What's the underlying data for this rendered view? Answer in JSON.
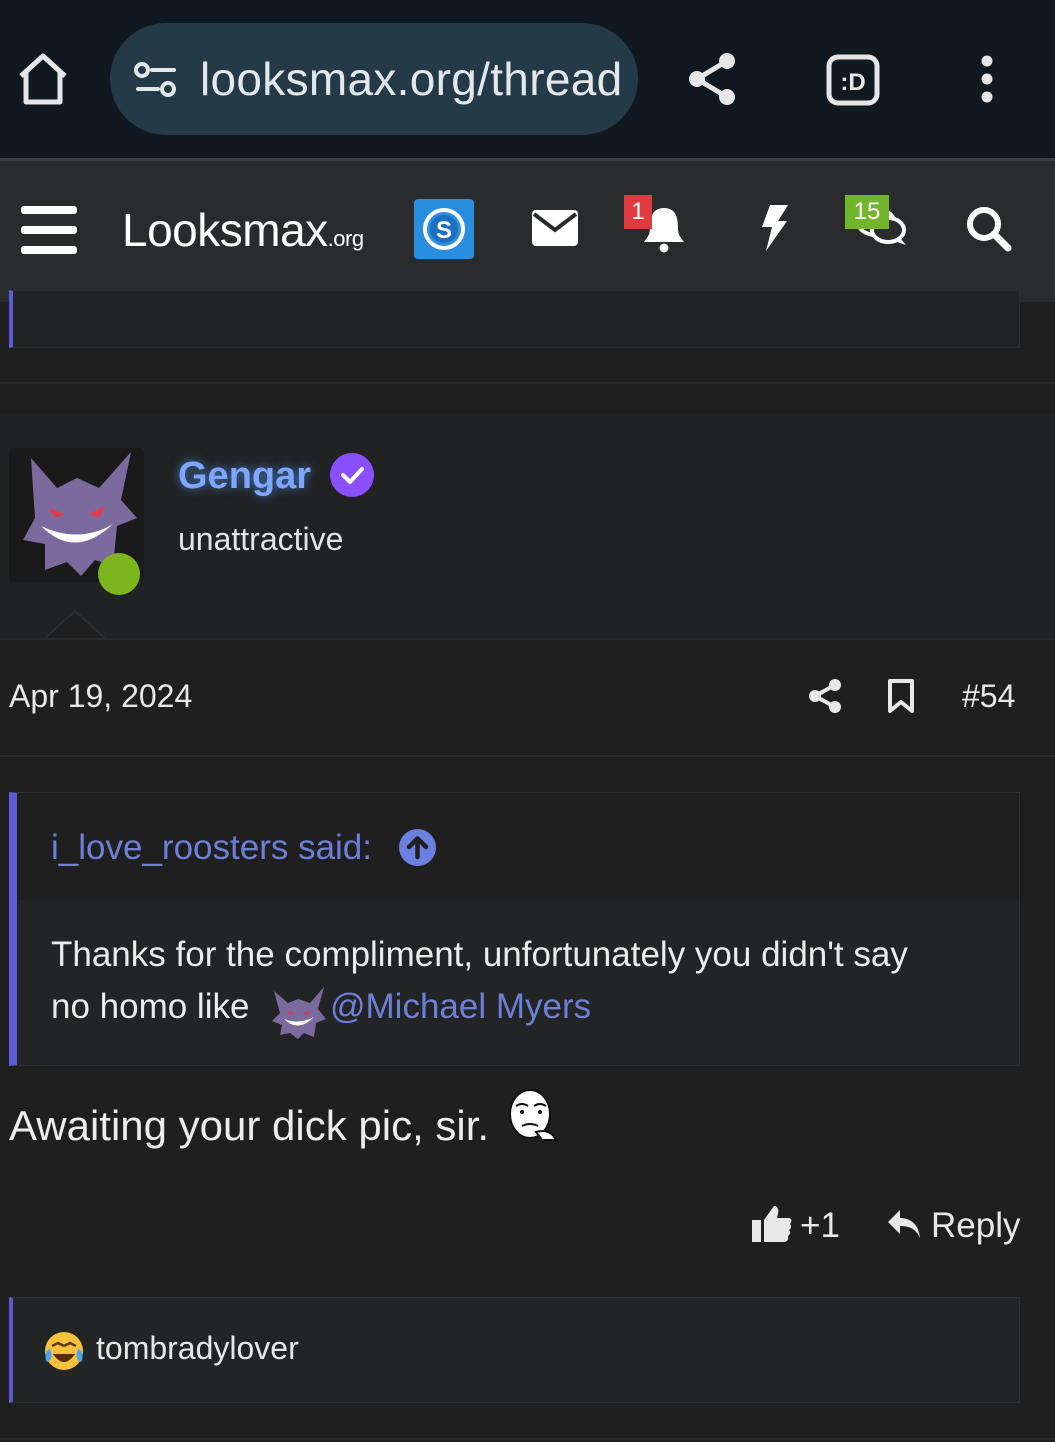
{
  "browser": {
    "url": "looksmax.org/thread",
    "icons": [
      "home-icon",
      "site-settings-icon",
      "share-icon",
      "extension-icon",
      "more-vert-icon"
    ]
  },
  "forum_header": {
    "logo_main": "Lᴏᴏksmax",
    "logo_suffix": ".org",
    "notification_count": "1",
    "conversation_count": "15",
    "icons": [
      "menu-icon",
      "skype-icon",
      "mail-icon",
      "bell-icon",
      "bolt-icon",
      "chat-icon",
      "search-icon"
    ]
  },
  "post": {
    "username": "Gengar",
    "user_title": "unattractive",
    "date": "Apr 19, 2024",
    "post_number": "#54",
    "quote": {
      "author_label": "i_love_roosters said:",
      "line1": "Thanks for the compliment, unfortunately you didn't say",
      "line2_prefix": "no homo like",
      "mention": "@Michael Myers"
    },
    "body": "Awaiting your dick pic, sir.",
    "like_label": "+1",
    "reply_label": "Reply",
    "reactor": "tombradylover"
  },
  "colors": {
    "accent": "#5b5bd6",
    "username": "#7ea6ff",
    "online": "#7cb51e",
    "notif_badge": "#e0393e",
    "convo_badge": "#72b42b",
    "background": "#1f1f20"
  }
}
